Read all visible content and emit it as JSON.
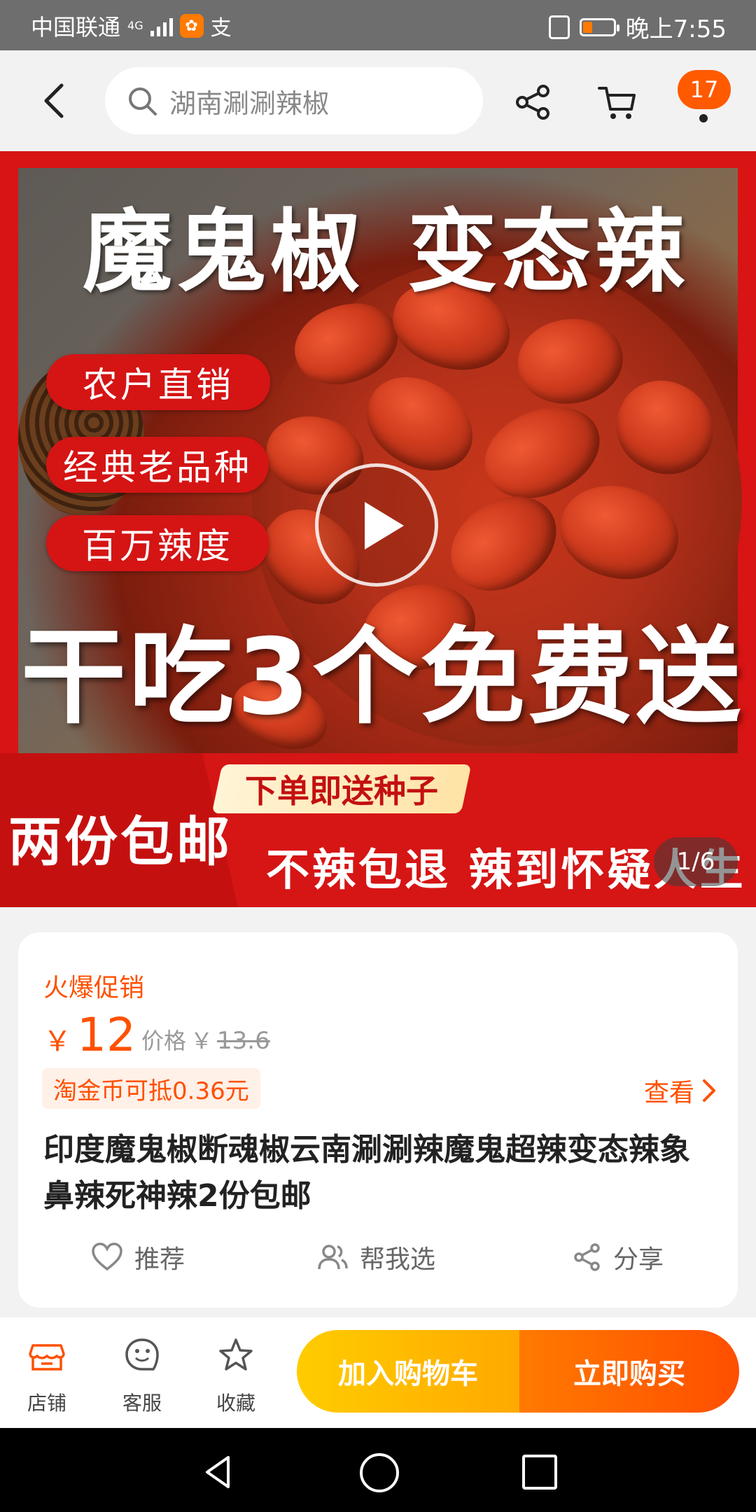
{
  "status_bar": {
    "carrier": "中国联通",
    "network": "4G",
    "time": "晚上7:55",
    "battery_level": 0.3,
    "icons": [
      "signal-icon",
      "uc-browser-icon",
      "alipay-icon",
      "vibrate-icon",
      "battery-icon"
    ]
  },
  "header": {
    "search_placeholder": "湖南涮涮辣椒",
    "cart_badge": "17",
    "icons": [
      "back-arrow-icon",
      "search-icon",
      "share-icon",
      "cart-icon",
      "more-icon"
    ]
  },
  "banner": {
    "title_left": "魔鬼椒",
    "title_right": "变态辣",
    "pills": [
      "农户直销",
      "经典老品种",
      "百万辣度"
    ],
    "headline": "干吃3个免费送",
    "seed_tag": "下单即送种子",
    "free_shipping": "两份包邮",
    "refund": "不辣包退 辣到怀疑人生",
    "counter": "1/6",
    "accent_color": "#d81414"
  },
  "product": {
    "promo_label": "火爆促销",
    "currency": "￥",
    "price": "12",
    "orig_label": "价格",
    "orig_currency": "￥",
    "orig_price": "13.6",
    "coin_offer": "淘金币可抵0.36元",
    "view_label": "查看",
    "title": "印度魔鬼椒断魂椒云南涮涮辣魔鬼超辣变态辣象鼻辣死神辣2份包邮",
    "actions": [
      {
        "label": "推荐",
        "icon": "heart-icon"
      },
      {
        "label": "帮我选",
        "icon": "people-icon"
      },
      {
        "label": "分享",
        "icon": "share-icon"
      }
    ],
    "price_color": "#ff5000"
  },
  "bottom_bar": {
    "tabs": [
      {
        "label": "店铺",
        "icon": "shop-icon"
      },
      {
        "label": "客服",
        "icon": "service-icon"
      },
      {
        "label": "收藏",
        "icon": "star-icon"
      }
    ],
    "add_to_cart": "加入购物车",
    "buy_now": "立即购买"
  }
}
